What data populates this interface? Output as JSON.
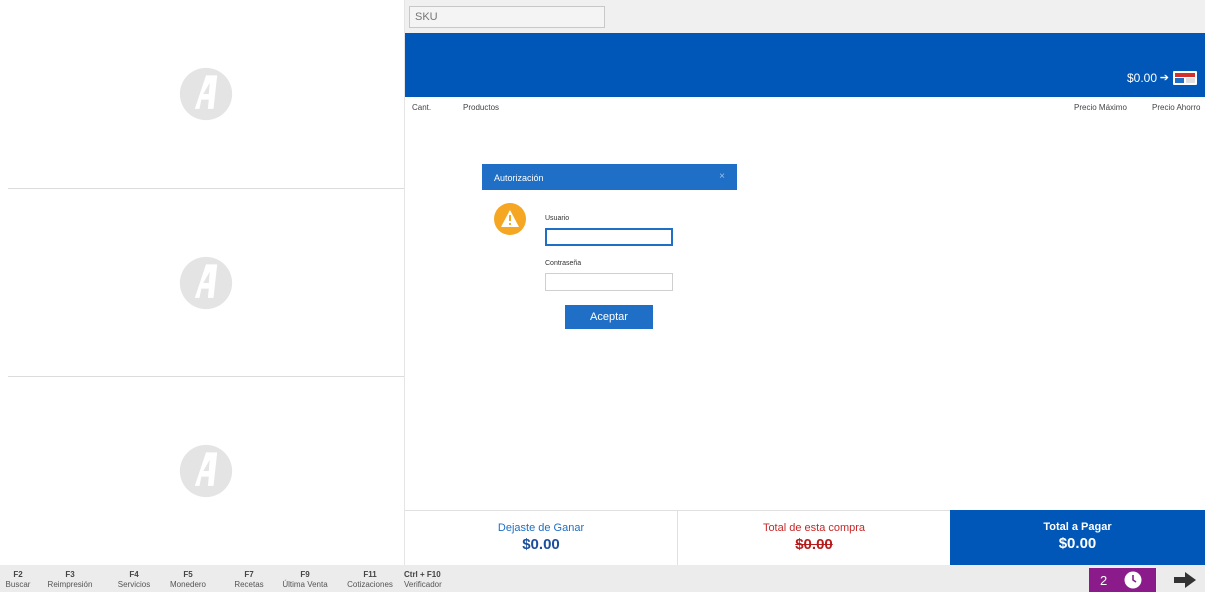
{
  "sku": {
    "placeholder": "SKU"
  },
  "header": {
    "cart_amount": "$0.00"
  },
  "columns": {
    "qty": "Cant.",
    "products": "Productos",
    "max_price": "Precio Máximo",
    "savings_price": "Precio Ahorro"
  },
  "dialog": {
    "title": "Autorización",
    "close": "×",
    "user_label": "Usuario",
    "password_label": "Contraseña",
    "accept": "Aceptar"
  },
  "summary": {
    "missed_label": "Dejaste de Ganar",
    "missed_value": "$0.00",
    "purchase_label": "Total de esta compra",
    "purchase_value": "$0.00",
    "total_label": "Total a Pagar",
    "total_value": "$0.00"
  },
  "footer": {
    "keys": [
      {
        "key": "F2",
        "label": "Buscar"
      },
      {
        "key": "F3",
        "label": "Reimpresión"
      },
      {
        "key": "F4",
        "label": "Servicios"
      },
      {
        "key": "F5",
        "label": "Monedero"
      },
      {
        "key": "F7",
        "label": "Recetas"
      },
      {
        "key": "F9",
        "label": "Última Venta"
      },
      {
        "key": "F11",
        "label": "Cotizaciones"
      },
      {
        "key": "Ctrl + F10",
        "label": "Verificador"
      }
    ],
    "queue_count": "2"
  },
  "colors": {
    "primary_blue": "#0057b8",
    "dialog_blue": "#1e6fc5",
    "warning_orange": "#f5a623",
    "queue_purple": "#8b1a8b",
    "loss_red": "#c62828"
  },
  "icons": [
    "logo-icon",
    "cart-icon",
    "close-icon",
    "warning-icon",
    "clock-icon",
    "arrow-right-icon"
  ]
}
